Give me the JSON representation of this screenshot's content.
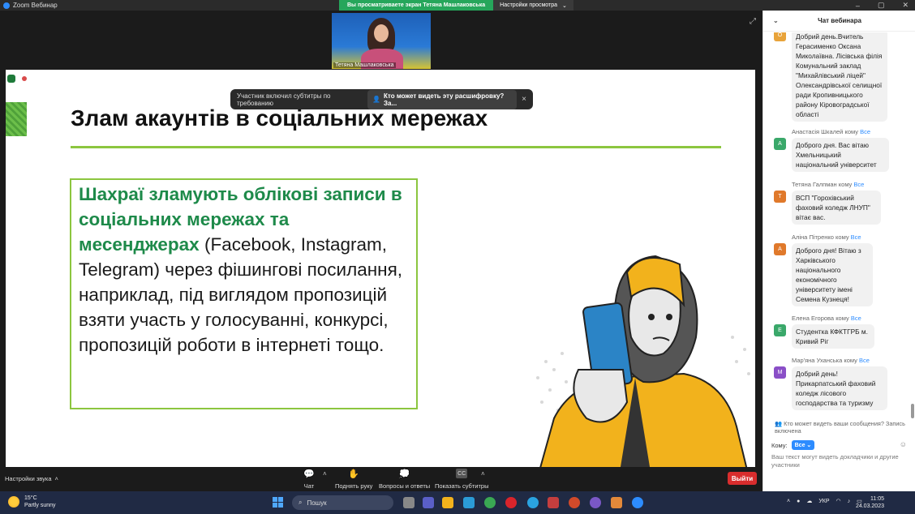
{
  "window": {
    "title": "Zoom Вебинар",
    "share_banner": "Вы просматриваете экран Тетяна Машлаковська",
    "view_options": "Настройки просмотра",
    "controls": [
      "–",
      "▢",
      "✕"
    ]
  },
  "video": {
    "participant_name": "Тетяна Машлаковська"
  },
  "toast": {
    "text": "Участник включил субтитры по требованию",
    "pill": "Кто может видеть эту расшифровку? За...",
    "close": "×"
  },
  "slide": {
    "title": "Злам акаунтів в соціальних мережах",
    "text_green": "Шахраї зламують облікові записи в соціальних мережах та месенджерах",
    "text_rest": " (Facebook, Instagram, Telegram) через фішингові посилання, наприклад, під виглядом пропозицій взяти участь у голосуванні, конкурсі, пропозицій роботи в інтернеті тощо."
  },
  "toolbar": {
    "audio_settings": "Настройки звука",
    "chat": "Чат",
    "raise_hand": "Поднять руку",
    "qa": "Вопросы и ответы",
    "captions": "Показать субтитры",
    "leave": "Выйти"
  },
  "chat": {
    "header": "Чат вебинара",
    "messages": [
      {
        "sender": "",
        "to": "",
        "avatar": "O",
        "color": "#e8a33a",
        "text": "Добрий день.Вчитель Герасименко Оксана Миколаївна. Лісівська філія Комунальний заклад \"Михайлівський ліцей\" Олександрівської селищної ради Кропивницького району Кіровоградської області"
      },
      {
        "sender": "Анастасія Шкалей кому",
        "to": "Все",
        "avatar": "А",
        "color": "#3aa86a",
        "text": "Доброго дня. Вас вітаю Хмельницький національний університет"
      },
      {
        "sender": "Тетяна Галпман кому",
        "to": "Все",
        "avatar": "Т",
        "color": "#e0792b",
        "text": "ВСП \"Горохівський фаховий коледж ЛНУП\" вітає вас."
      },
      {
        "sender": "Аліна Пітренко кому",
        "to": "Все",
        "avatar": "А",
        "color": "#e0792b",
        "text": "Доброго дня! Вітаю з Харківського національного економічного університету імені Семена Кузнеця!"
      },
      {
        "sender": "Елена Егорова кому",
        "to": "Все",
        "avatar": "Е",
        "color": "#3aa86a",
        "text": "Студентка КФКТГРБ м. Кривий Ріг"
      },
      {
        "sender": "Мар'яна Уханська кому",
        "to": "Все",
        "avatar": "М",
        "color": "#8a4fc7",
        "text": "Добрий день! Прикарпатський фаховий коледж лісового господарства та туризму"
      }
    ],
    "visibility_note": "Кто может видеть ваши сообщения? Запись включена",
    "to_label": "Кому:",
    "to_value": "Все",
    "input_placeholder": "Ваш текст могут видеть докладчики и другие участники"
  },
  "taskbar": {
    "temp": "15°C",
    "weather": "Partly sunny",
    "search": "Пошук",
    "lang": "УКР",
    "time": "11:05",
    "date": "24.03.2023"
  }
}
